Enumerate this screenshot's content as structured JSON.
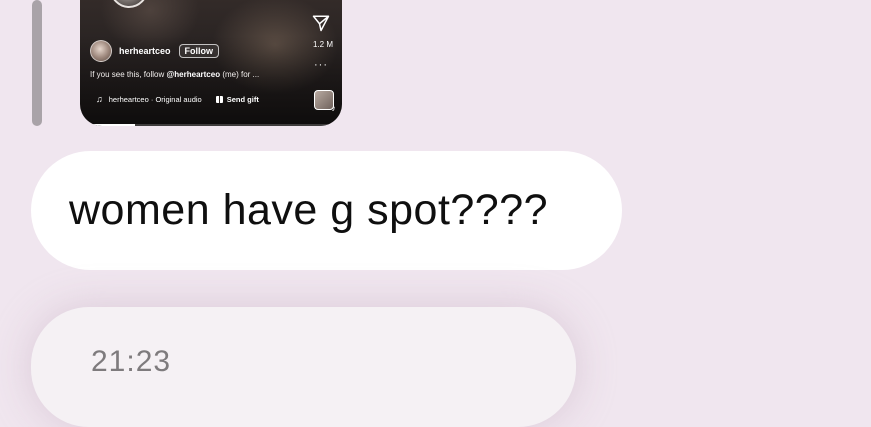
{
  "reel": {
    "username": "herheartceo",
    "follow_label": "Follow",
    "share_count": "1.2 M",
    "more_label": "···",
    "caption_prefix": "If you see this, follow ",
    "caption_mention": "@herheartceo",
    "caption_suffix": " (me) for ...",
    "audio_text": "herheartceo · Original audio",
    "gift_label": "Send gift",
    "progress": 0.21
  },
  "message": {
    "text": "women have g spot????"
  },
  "time_card": {
    "time": "21:23"
  },
  "colors": {
    "background": "#F0E6EF",
    "bubble": "#FFFFFF",
    "reply_bar": "#A9A3A8"
  }
}
